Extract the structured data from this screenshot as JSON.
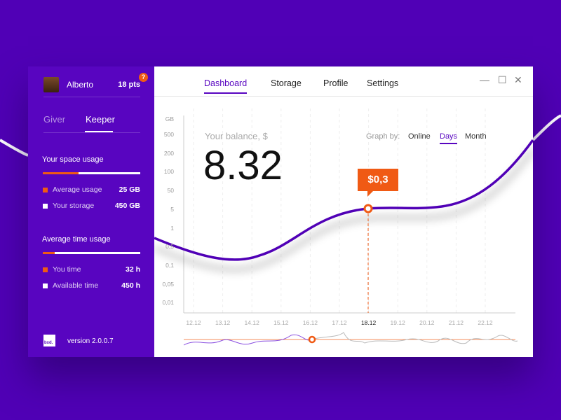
{
  "sidebar": {
    "user_name": "Alberto",
    "points": "18 pts",
    "help": "?",
    "tabs": [
      "Giver",
      "Keeper"
    ],
    "space": {
      "title": "Your space usage",
      "fill": 0.37,
      "items": [
        {
          "label": "Average usage",
          "value": "25 GB"
        },
        {
          "label": "Your storage",
          "value": "450 GB"
        }
      ]
    },
    "time": {
      "title": "Average time usage",
      "fill": 0.12,
      "items": [
        {
          "label": "You time",
          "value": "32 h"
        },
        {
          "label": "Available time",
          "value": "450 h"
        }
      ]
    },
    "logo": "bxd.",
    "version": "version 2.0.0.7"
  },
  "nav": {
    "items": [
      "Dashboard",
      "Storage",
      "Profile",
      "Settings"
    ],
    "active": "Dashboard"
  },
  "window_controls": {
    "minimize": "—",
    "maximize": "☐",
    "close": "✕"
  },
  "main": {
    "balance_label": "Your balance, $",
    "balance_value": "8.32",
    "graph_by_label": "Graph by:",
    "graph_options": [
      "Online",
      "Days",
      "Month"
    ],
    "graph_active": "Days",
    "tooltip": "$0,3"
  },
  "chart_data": {
    "type": "line",
    "yunit": "GB",
    "yticks": [
      "500",
      "200",
      "100",
      "50",
      "5",
      "1",
      "0,5",
      "0,1",
      "0,05",
      "0,01"
    ],
    "xticks": [
      "12.12",
      "13.12",
      "14.12",
      "15.12",
      "16.12",
      "17.12",
      "18.12",
      "19.12",
      "20.12",
      "21.12",
      "22.12"
    ],
    "selected_x": "18.12",
    "selected_label": "$0,3"
  },
  "colors": {
    "bg": "#5000b6",
    "accent": "#5805c0",
    "orange": "#f05a14"
  }
}
